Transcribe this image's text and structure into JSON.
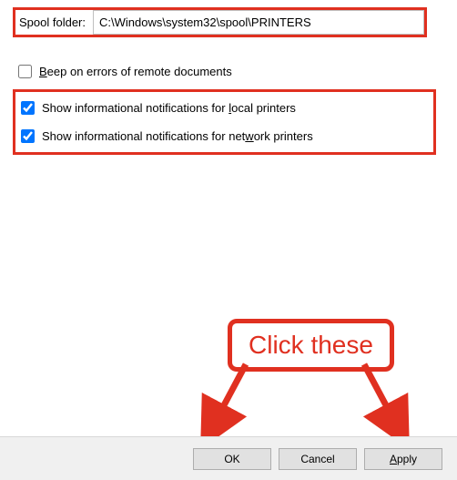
{
  "spool": {
    "label": "Spool folder:",
    "value": "C:\\Windows\\system32\\spool\\PRINTERS"
  },
  "checkboxes": {
    "beep": {
      "label_pre": "",
      "hotkey": "B",
      "label_post": "eep on errors of remote documents",
      "checked": false
    },
    "local": {
      "label_pre": "Show informational notifications for ",
      "hotkey": "l",
      "label_post": "ocal printers",
      "checked": true
    },
    "network": {
      "label_pre": "Show informational notifications for net",
      "hotkey": "w",
      "label_post": "ork printers",
      "checked": true
    }
  },
  "buttons": {
    "ok": "OK",
    "cancel": "Cancel",
    "apply_hotkey": "A",
    "apply_post": "pply"
  },
  "annotation": {
    "callout": "Click these",
    "highlight_color": "#e03020"
  }
}
